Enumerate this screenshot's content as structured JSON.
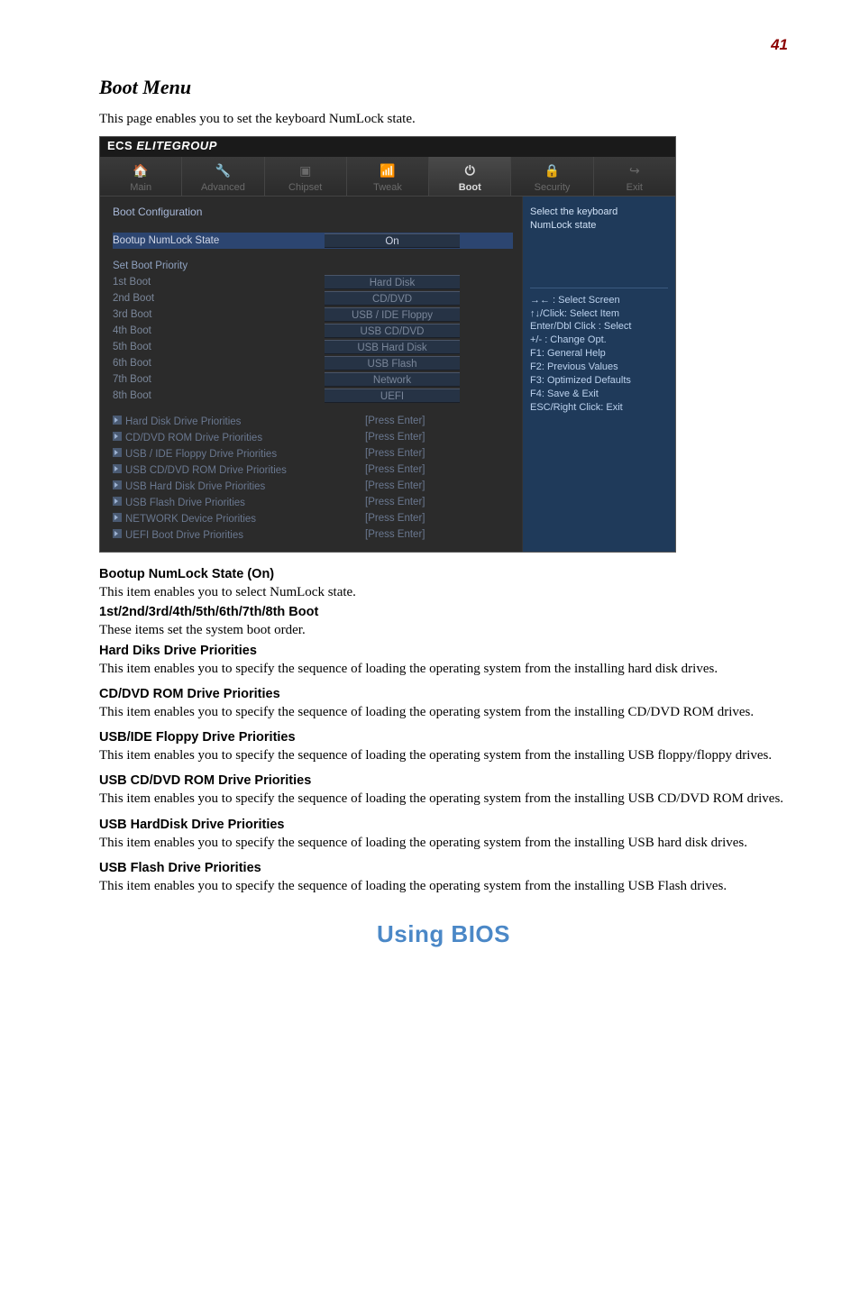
{
  "page_number": "41",
  "section_title": "Boot Menu",
  "intro": "This page enables you to set the keyboard NumLock state.",
  "bios": {
    "brand": "ELITEGROUP",
    "tabs": [
      "Main",
      "Advanced",
      "Chipset",
      "Tweak",
      "Boot",
      "Security",
      "Exit"
    ],
    "active_tab": "Boot",
    "config_title": "Boot Configuration",
    "numlock_row": {
      "label": "Bootup NumLock State",
      "value": "On"
    },
    "priority_title": "Set Boot Priority",
    "boot_order": [
      {
        "label": "1st Boot",
        "value": "Hard Disk"
      },
      {
        "label": "2nd Boot",
        "value": "CD/DVD"
      },
      {
        "label": "3rd Boot",
        "value": "USB /  IDE Floppy"
      },
      {
        "label": "4th Boot",
        "value": "USB CD/DVD"
      },
      {
        "label": "5th Boot",
        "value": "USB Hard Disk"
      },
      {
        "label": "6th Boot",
        "value": "USB Flash"
      },
      {
        "label": "7th Boot",
        "value": "Network"
      },
      {
        "label": "8th Boot",
        "value": "UEFI"
      }
    ],
    "priorities": [
      {
        "label": "Hard Disk Drive Priorities",
        "value": "[Press Enter]"
      },
      {
        "label": "CD/DVD ROM Drive  Priorities",
        "value": "[Press Enter]"
      },
      {
        "label": "USB / IDE Floppy Drive  Priorities",
        "value": "[Press Enter]"
      },
      {
        "label": "USB CD/DVD ROM Drive  Priorities",
        "value": "[Press Enter]"
      },
      {
        "label": "USB Hard Disk Drive  Priorities",
        "value": "[Press Enter]"
      },
      {
        "label": "USB Flash Drive  Priorities",
        "value": "[Press Enter]"
      },
      {
        "label": "NETWORK Device  Priorities",
        "value": "[Press Enter]"
      },
      {
        "label": "UEFI Boot Drive  Priorities",
        "value": "[Press Enter]"
      }
    ],
    "help_top1": "Select the keyboard",
    "help_top2": "NumLock state",
    "help_lines": [
      "→←   : Select Screen",
      "↑↓/Click: Select Item",
      "Enter/Dbl Click : Select",
      "+/- : Change Opt.",
      "F1: General Help",
      "F2: Previous Values",
      "F3: Optimized Defaults",
      "F4: Save & Exit",
      "ESC/Right Click: Exit"
    ]
  },
  "sections": [
    {
      "heading": "Bootup NumLock State (On)",
      "text": "This item enables you to select NumLock state."
    },
    {
      "heading": "1st/2nd/3rd/4th/5th/6th/7th/8th Boot",
      "text": "These items set the system boot order."
    },
    {
      "heading": "Hard Diks Drive Priorities",
      "text": "This item enables you to specify the sequence of loading the operating system from the installing hard disk drives."
    },
    {
      "heading": "CD/DVD ROM Drive Priorities",
      "text": "This item enables you to specify the sequence of loading the operating system from the installing CD/DVD ROM drives."
    },
    {
      "heading": "USB/IDE Floppy Drive Priorities",
      "text": "This item enables you to specify the sequence of loading the operating system from the installing USB floppy/floppy drives."
    },
    {
      "heading": "USB CD/DVD ROM Drive Priorities",
      "text": "This item enables you to specify the sequence of loading the operating system from the installing USB CD/DVD ROM drives."
    },
    {
      "heading": "USB HardDisk Drive Priorities",
      "text": "This item enables you to specify the sequence of loading the operating system from the installing USB hard disk drives."
    },
    {
      "heading": "USB Flash Drive Priorities",
      "text": "This item enables you to specify the sequence of loading the operating system from the installing USB Flash drives."
    }
  ],
  "footer": "Using BIOS"
}
